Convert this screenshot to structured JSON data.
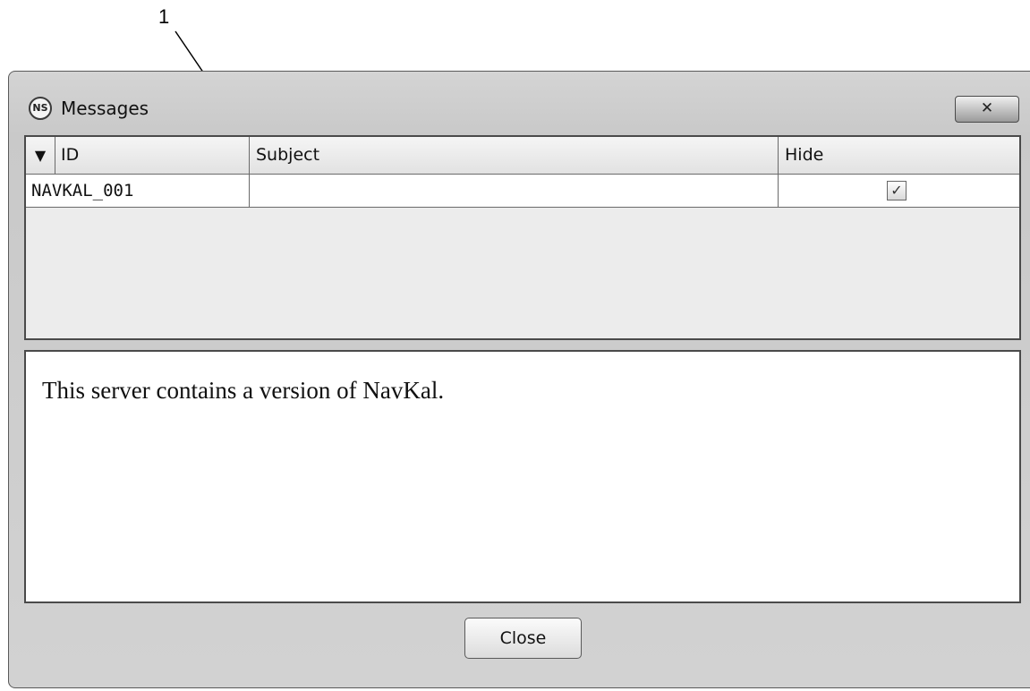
{
  "callout": {
    "label": "1"
  },
  "window": {
    "title": "Messages",
    "app_icon": "ns-logo-icon",
    "close_icon": "close-icon",
    "close_glyph": "✕"
  },
  "table": {
    "filter_icon": "filter-icon",
    "filter_glyph": "▼",
    "columns": [
      "ID",
      "Subject",
      "Hide"
    ],
    "rows": [
      {
        "id": "NAVKAL_001",
        "subject": "",
        "hide": true
      }
    ],
    "checkmark_glyph": "✓"
  },
  "message": {
    "text": "This server contains a version of NavKal."
  },
  "footer": {
    "close_label": "Close"
  }
}
